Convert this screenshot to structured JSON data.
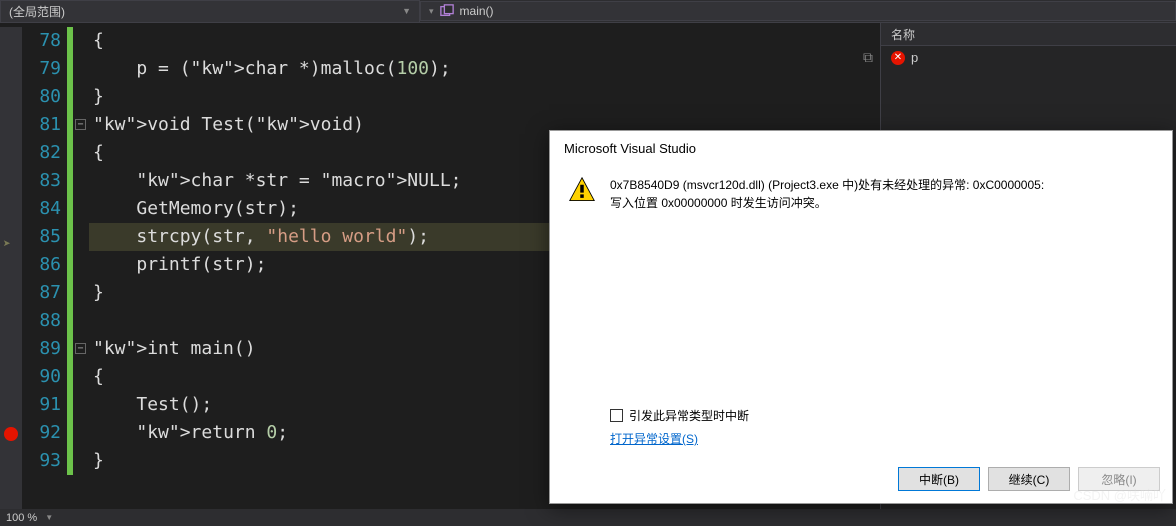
{
  "topbar": {
    "scope_label": "(全局范围)",
    "function_label": "main()"
  },
  "watch": {
    "header": "名称",
    "items": [
      {
        "name": "p"
      }
    ]
  },
  "editor": {
    "current_line": 85,
    "breakpoint_line": 92,
    "lines": [
      {
        "n": 78,
        "raw": "{"
      },
      {
        "n": 79,
        "raw": "    p = (char *)malloc(100);"
      },
      {
        "n": 80,
        "raw": "}"
      },
      {
        "n": 81,
        "raw": "void Test(void)",
        "fold": true
      },
      {
        "n": 82,
        "raw": "{"
      },
      {
        "n": 83,
        "raw": "    char *str = NULL;"
      },
      {
        "n": 84,
        "raw": "    GetMemory(str);"
      },
      {
        "n": 85,
        "raw": "    strcpy(str, \"hello world\");"
      },
      {
        "n": 86,
        "raw": "    printf(str);"
      },
      {
        "n": 87,
        "raw": "}"
      },
      {
        "n": 88,
        "raw": ""
      },
      {
        "n": 89,
        "raw": "int main()",
        "fold": true
      },
      {
        "n": 90,
        "raw": "{"
      },
      {
        "n": 91,
        "raw": "    Test();"
      },
      {
        "n": 92,
        "raw": "    return 0;"
      },
      {
        "n": 93,
        "raw": "}"
      }
    ]
  },
  "dialog": {
    "title": "Microsoft Visual Studio",
    "message_line1": "0x7B8540D9 (msvcr120d.dll) (Project3.exe 中)处有未经处理的异常:  0xC0000005:",
    "message_line2": "写入位置 0x00000000 时发生访问冲突。",
    "checkbox_label": "引发此异常类型时中断",
    "link_label": "打开异常设置(S)",
    "btn_break": "中断(B)",
    "btn_continue": "继续(C)",
    "btn_ignore": "忽略(I)"
  },
  "status": {
    "zoom": "100 %"
  },
  "watermark": "CSDN @呋喃吖"
}
